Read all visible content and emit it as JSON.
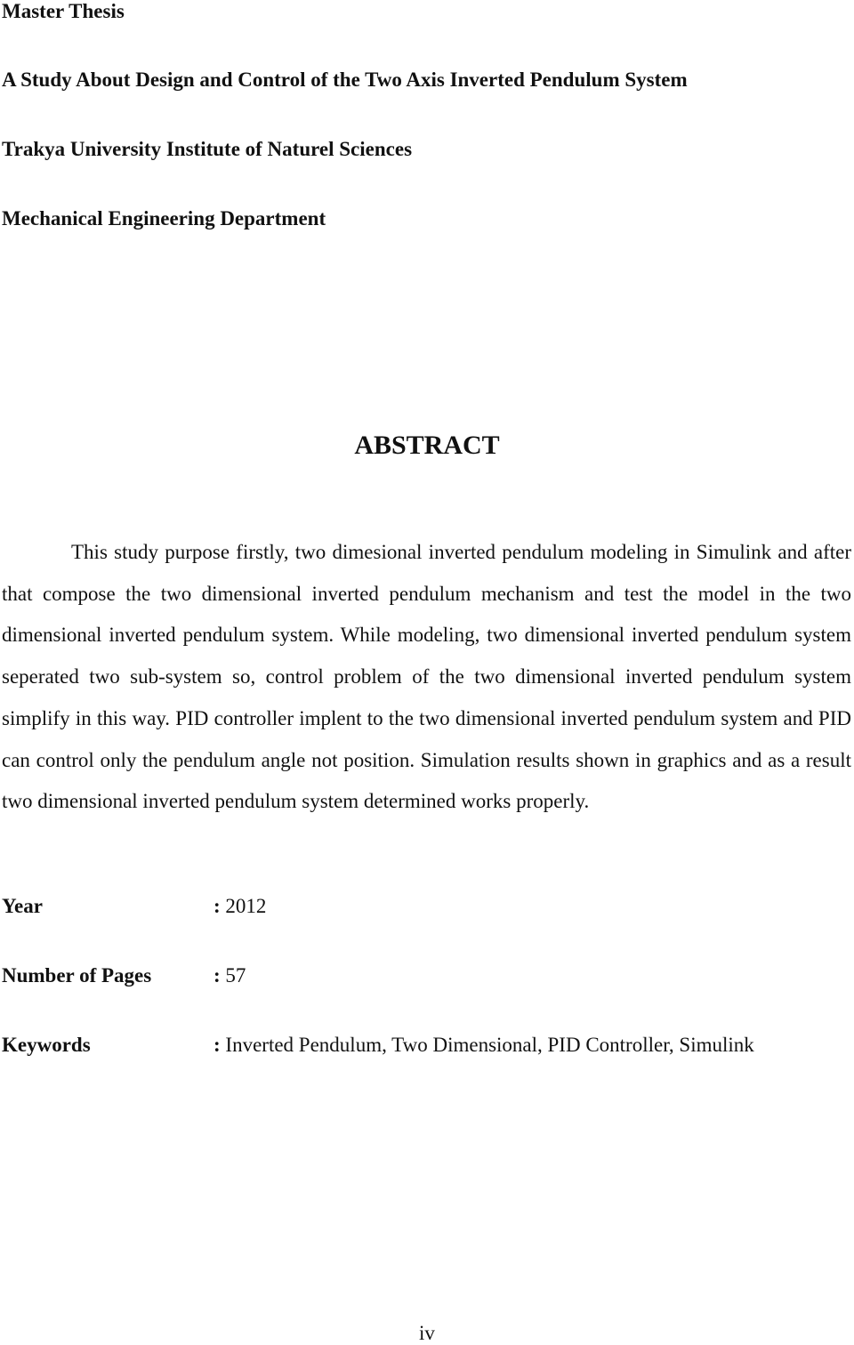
{
  "header": {
    "thesis_type": "Master Thesis",
    "title": "A Study About Design and Control of the Two Axis Inverted Pendulum System",
    "institution": "Trakya University Institute of Naturel Sciences",
    "department": "Mechanical Engineering Department"
  },
  "abstract": {
    "heading": "ABSTRACT",
    "body": "This study purpose firstly, two dimesional inverted pendulum modeling in Simulink and after that compose the two dimensional inverted pendulum mechanism and test the model in the two dimensional inverted pendulum system. While modeling, two dimensional inverted pendulum system seperated two sub-system so, control problem of the two dimensional inverted pendulum system simplify in this way. PID controller implent to the two dimensional inverted pendulum system and PID can control only the pendulum angle not position. Simulation results shown in graphics and as a result two dimensional inverted pendulum system determined works properly."
  },
  "meta": [
    {
      "label": "Year",
      "value": "2012"
    },
    {
      "label": "Number of Pages",
      "value": "57"
    },
    {
      "label": "Keywords",
      "value": "Inverted Pendulum, Two Dimensional, PID Controller, Simulink"
    }
  ],
  "colon": ":",
  "page_number": "iv"
}
